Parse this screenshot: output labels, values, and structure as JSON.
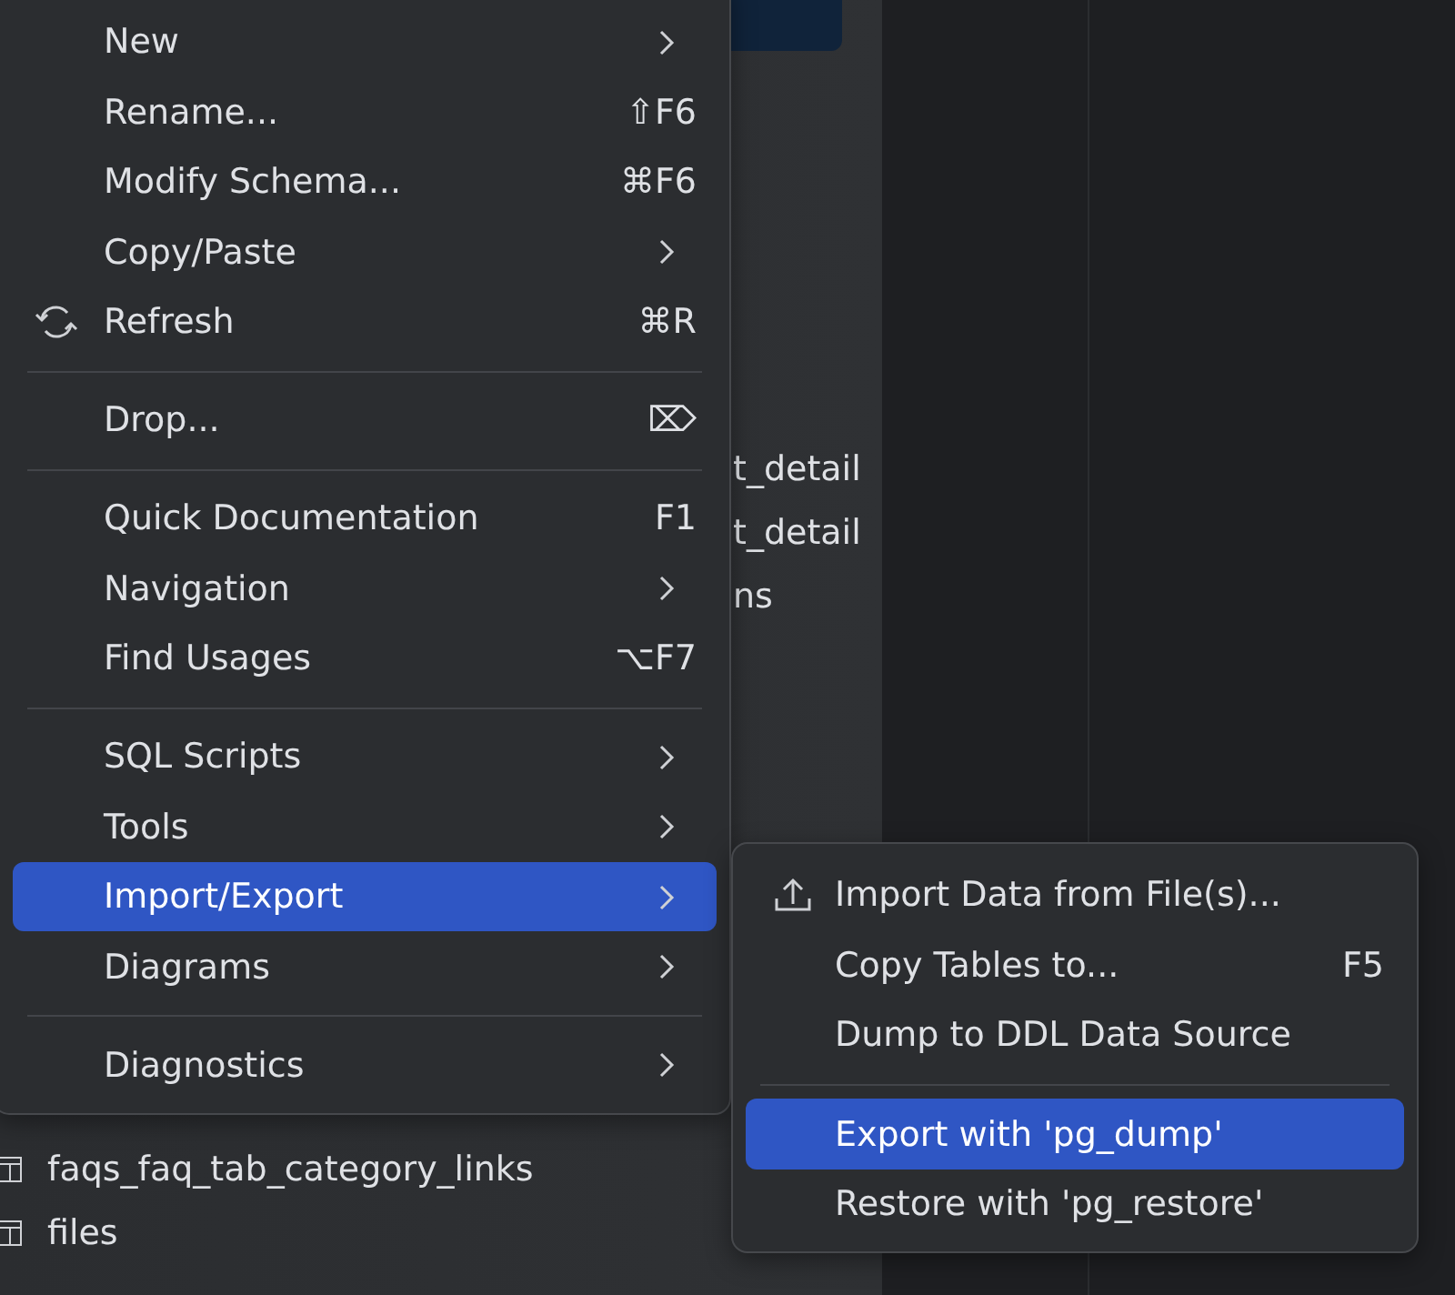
{
  "tree_fragments": [
    {
      "label": "t_detail"
    },
    {
      "label": "t_detail"
    },
    {
      "label": "ns"
    }
  ],
  "tree": [
    {
      "label": "faqs_faq_tab_category_links"
    },
    {
      "label": "files"
    }
  ],
  "context_menu": [
    {
      "kind": "item",
      "label": "New",
      "submenu": true,
      "selected": false
    },
    {
      "kind": "item",
      "label": "Rename...",
      "shortcut": "⇧F6",
      "selected": false
    },
    {
      "kind": "item",
      "label": "Modify Schema...",
      "shortcut": "⌘F6",
      "selected": false
    },
    {
      "kind": "item",
      "label": "Copy/Paste",
      "submenu": true,
      "selected": false
    },
    {
      "kind": "item",
      "label": "Refresh",
      "shortcut": "⌘R",
      "icon": true,
      "selected": false
    },
    {
      "kind": "separator"
    },
    {
      "kind": "item",
      "label": "Drop...",
      "shortcut": "⌦",
      "selected": false
    },
    {
      "kind": "separator"
    },
    {
      "kind": "item",
      "label": "Quick Documentation",
      "shortcut": "F1",
      "selected": false
    },
    {
      "kind": "item",
      "label": "Navigation",
      "submenu": true,
      "selected": false
    },
    {
      "kind": "item",
      "label": "Find Usages",
      "shortcut": "⌥F7",
      "selected": false
    },
    {
      "kind": "separator"
    },
    {
      "kind": "item",
      "label": "SQL Scripts",
      "submenu": true,
      "selected": false
    },
    {
      "kind": "item",
      "label": "Tools",
      "submenu": true,
      "selected": false
    },
    {
      "kind": "item",
      "label": "Import/Export",
      "submenu": true,
      "selected": true
    },
    {
      "kind": "item",
      "label": "Diagrams",
      "submenu": true,
      "selected": false
    },
    {
      "kind": "separator"
    },
    {
      "kind": "item",
      "label": "Diagnostics",
      "submenu": true,
      "selected": false
    }
  ],
  "submenu": [
    {
      "kind": "item",
      "label": "Import Data from File(s)...",
      "icon": true,
      "selected": false
    },
    {
      "kind": "item",
      "label": "Copy Tables to...",
      "shortcut": "F5",
      "selected": false
    },
    {
      "kind": "item",
      "label": "Dump to DDL Data Source",
      "selected": false
    },
    {
      "kind": "separator"
    },
    {
      "kind": "item",
      "label": "Export with 'pg_dump'",
      "selected": true
    },
    {
      "kind": "item",
      "label": "Restore with 'pg_restore'",
      "selected": false
    }
  ]
}
